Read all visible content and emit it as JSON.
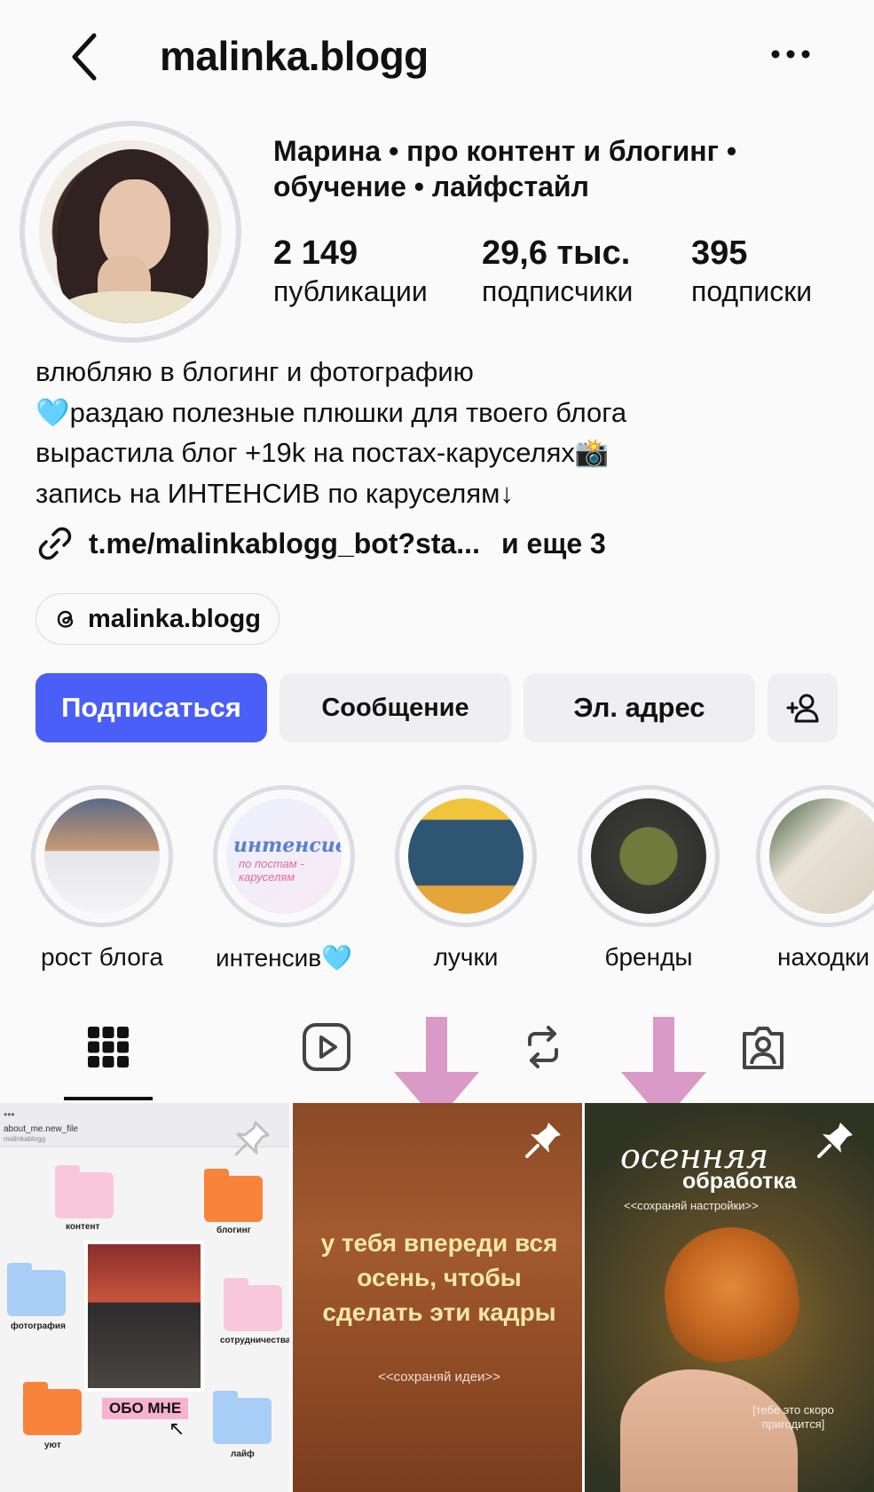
{
  "header": {
    "username": "malinka.blogg"
  },
  "profile": {
    "full_name_line1": "Марина • про контент и блогинг •",
    "full_name_line2": "обучение • лайфстайл",
    "stats": {
      "posts_value": "2 149",
      "posts_label": "публикации",
      "followers_value": "29,6 тыс.",
      "followers_label": "подписчики",
      "following_value": "395",
      "following_label": "подписки"
    },
    "bio": [
      "влюбляю в блогинг и фотографию",
      "🩵раздаю полезные плюшки для твоего блога",
      "вырастила блог +19k на постах-каруселях📸",
      "запись на ИНТЕНСИВ по каруселям↓"
    ],
    "link": {
      "text": "t.me/malinkablogg_bot?sta...",
      "more": "и еще 3"
    },
    "threads_handle": "malinka.blogg"
  },
  "actions": {
    "follow": "Подписаться",
    "message": "Сообщение",
    "email": "Эл. адрес"
  },
  "highlights": [
    {
      "label": "рост блога"
    },
    {
      "label": "интенсив🩵"
    },
    {
      "label": "лучки"
    },
    {
      "label": "бренды"
    },
    {
      "label": "находки"
    }
  ],
  "highlight_texts": {
    "intensiv_title": "интенсив",
    "intensiv_sub": "по постам - каруселям"
  },
  "posts": [
    {
      "file_title": "about_me.new_file",
      "file_sub": "malinkablogg",
      "folders": [
        "контент",
        "блогинг",
        "фотография",
        "сотрудничества",
        "уют",
        "лайф"
      ],
      "badge": "ОБО МНЕ"
    },
    {
      "text": "у тебя впереди вся осень, чтобы сделать эти кадры",
      "sub": "<<сохраняй идеи>>"
    },
    {
      "title1": "осенняя",
      "title2": "обработка",
      "sub": "<<сохраняй настройки>>",
      "note": "[тебе это скоро пригодится]"
    }
  ],
  "colors": {
    "follow_button": "#4a5ff7",
    "secondary_button": "#efeff2",
    "arrow_pink": "#d99ac7"
  },
  "icons": {
    "back": "chevron-left-icon",
    "more": "more-dots-icon",
    "link": "link-icon",
    "threads": "threads-icon",
    "add_user": "add-user-icon",
    "grid": "grid-icon",
    "reels": "reels-icon",
    "repost": "repost-icon",
    "tagged": "tagged-icon",
    "pin": "pin-icon"
  }
}
